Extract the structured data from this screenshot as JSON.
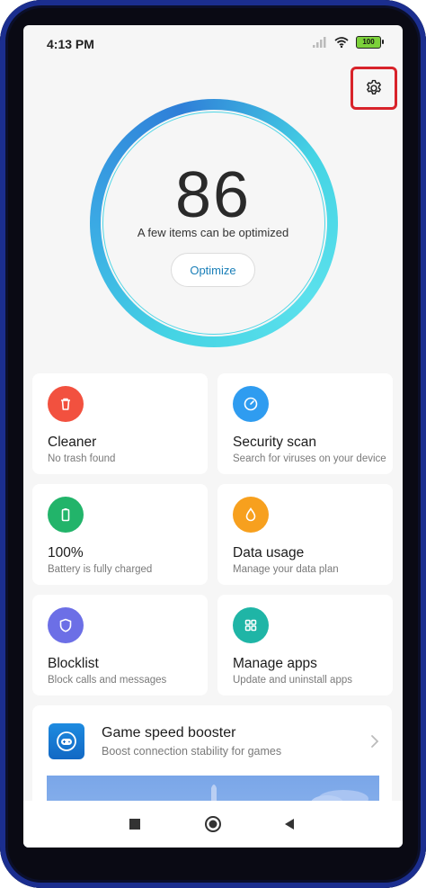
{
  "status_bar": {
    "time": "4:13 PM",
    "battery": "100",
    "icons": [
      "signal-icon",
      "wifi-icon",
      "battery-icon"
    ]
  },
  "header": {
    "settings_icon": "gear-icon"
  },
  "score": {
    "value": "86",
    "subtitle": "A few items can be optimized",
    "button_label": "Optimize"
  },
  "features": [
    {
      "title": "Cleaner",
      "subtitle": "No trash found",
      "icon": "trash-icon",
      "color": "#f2513f"
    },
    {
      "title": "Security scan",
      "subtitle": "Search for viruses on your device",
      "icon": "scan-gauge-icon",
      "color": "#2f9cf0"
    },
    {
      "title": "100%",
      "subtitle": "Battery is fully charged",
      "icon": "battery-icon",
      "color": "#22b46a"
    },
    {
      "title": "Data usage",
      "subtitle": "Manage your data plan",
      "icon": "droplet-icon",
      "color": "#f7a01e"
    },
    {
      "title": "Blocklist",
      "subtitle": "Block calls and messages",
      "icon": "shield-icon",
      "color": "#6c6fe6"
    },
    {
      "title": "Manage apps",
      "subtitle": "Update and uninstall apps",
      "icon": "grid-icon",
      "color": "#1fb5a6"
    }
  ],
  "game_booster": {
    "title": "Game speed booster",
    "subtitle": "Boost connection stability for games",
    "icon": "gamepad-icon"
  },
  "navbar": {
    "icons": [
      "recents-square-icon",
      "home-circle-icon",
      "back-triangle-icon"
    ]
  },
  "colors": {
    "ring": "#45d4e4",
    "accent": "#1a7fb8",
    "highlight": "#d8232a"
  }
}
